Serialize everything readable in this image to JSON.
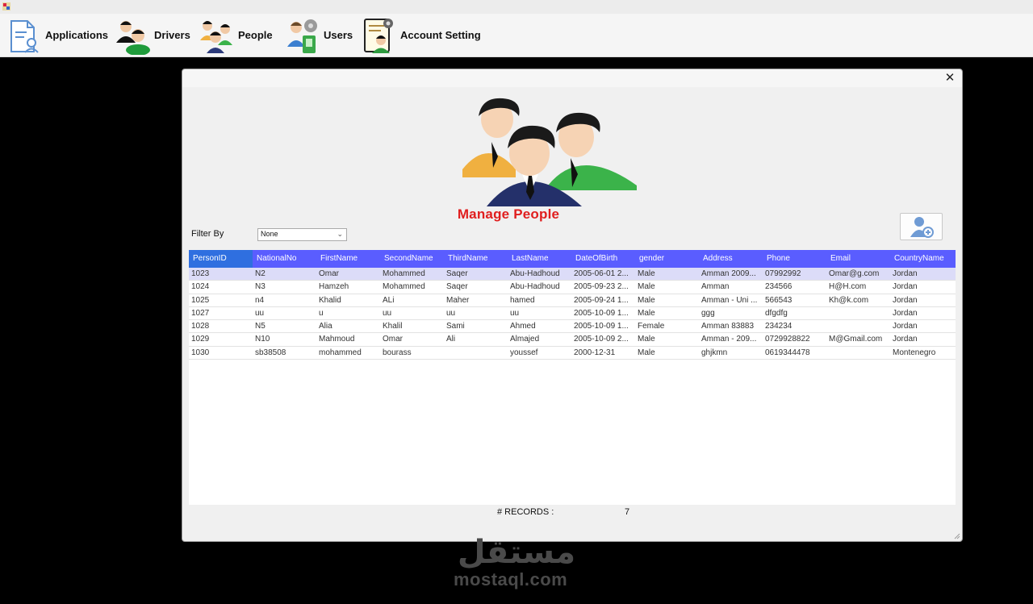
{
  "menu": {
    "items": [
      {
        "label": "Applications",
        "icon": "applications-icon"
      },
      {
        "label": "Drivers",
        "icon": "drivers-icon"
      },
      {
        "label": "People",
        "icon": "people-icon"
      },
      {
        "label": "Users",
        "icon": "users-icon"
      },
      {
        "label": "Account Setting",
        "icon": "account-setting-icon"
      }
    ]
  },
  "dialog": {
    "close_glyph": "✕",
    "title": "Manage People",
    "filter": {
      "label": "Filter By",
      "selected": "None"
    },
    "add_icon": "add-person-icon",
    "records_label": "# RECORDS :",
    "records_count": "7"
  },
  "table": {
    "columns": [
      "PersonID",
      "NationalNo",
      "FirstName",
      "SecondName",
      "ThirdName",
      "LastName",
      "DateOfBirth",
      "gender",
      "Address",
      "Phone",
      "Email",
      "CountryName"
    ],
    "rows": [
      [
        "1023",
        "N2",
        "Omar",
        "Mohammed",
        "Saqer",
        "Abu-Hadhoud",
        "2005-06-01 2...",
        "Male",
        "Amman 2009...",
        "07992992",
        "Omar@g.com",
        "Jordan"
      ],
      [
        "1024",
        "N3",
        "Hamzeh",
        "Mohammed",
        "Saqer",
        "Abu-Hadhoud",
        "2005-09-23 2...",
        "Male",
        "Amman",
        "234566",
        "H@H.com",
        "Jordan"
      ],
      [
        "1025",
        "n4",
        "Khalid",
        "ALi",
        "Maher",
        "hamed",
        "2005-09-24 1...",
        "Male",
        "Amman - Uni ...",
        "566543",
        "Kh@k.com",
        "Jordan"
      ],
      [
        "1027",
        "uu",
        "u",
        "uu",
        "uu",
        "uu",
        "2005-10-09 1...",
        "Male",
        "ggg",
        "dfgdfg",
        "",
        "Jordan"
      ],
      [
        "1028",
        "N5",
        "Alia",
        "Khalil",
        "Sami",
        "Ahmed",
        "2005-10-09 1...",
        "Female",
        "Amman 83883",
        "234234",
        "",
        "Jordan"
      ],
      [
        "1029",
        "N10",
        "Mahmoud",
        "Omar",
        "Ali",
        "Almajed",
        "2005-10-09 2...",
        "Male",
        "Amman - 209...",
        "0729928822",
        "M@Gmail.com",
        "Jordan"
      ],
      [
        "1030",
        "sb38508",
        "mohammed",
        "bourass",
        "",
        "youssef",
        "2000-12-31",
        "Male",
        "ghjkmn",
        "0619344478",
        "",
        "Montenegro"
      ]
    ]
  },
  "watermark": {
    "arabic": "مستقل",
    "text": "mostaql.com"
  },
  "colors": {
    "header": "#5a5dff",
    "title": "#e01e1e",
    "selected_row": "#dcdcf8"
  }
}
